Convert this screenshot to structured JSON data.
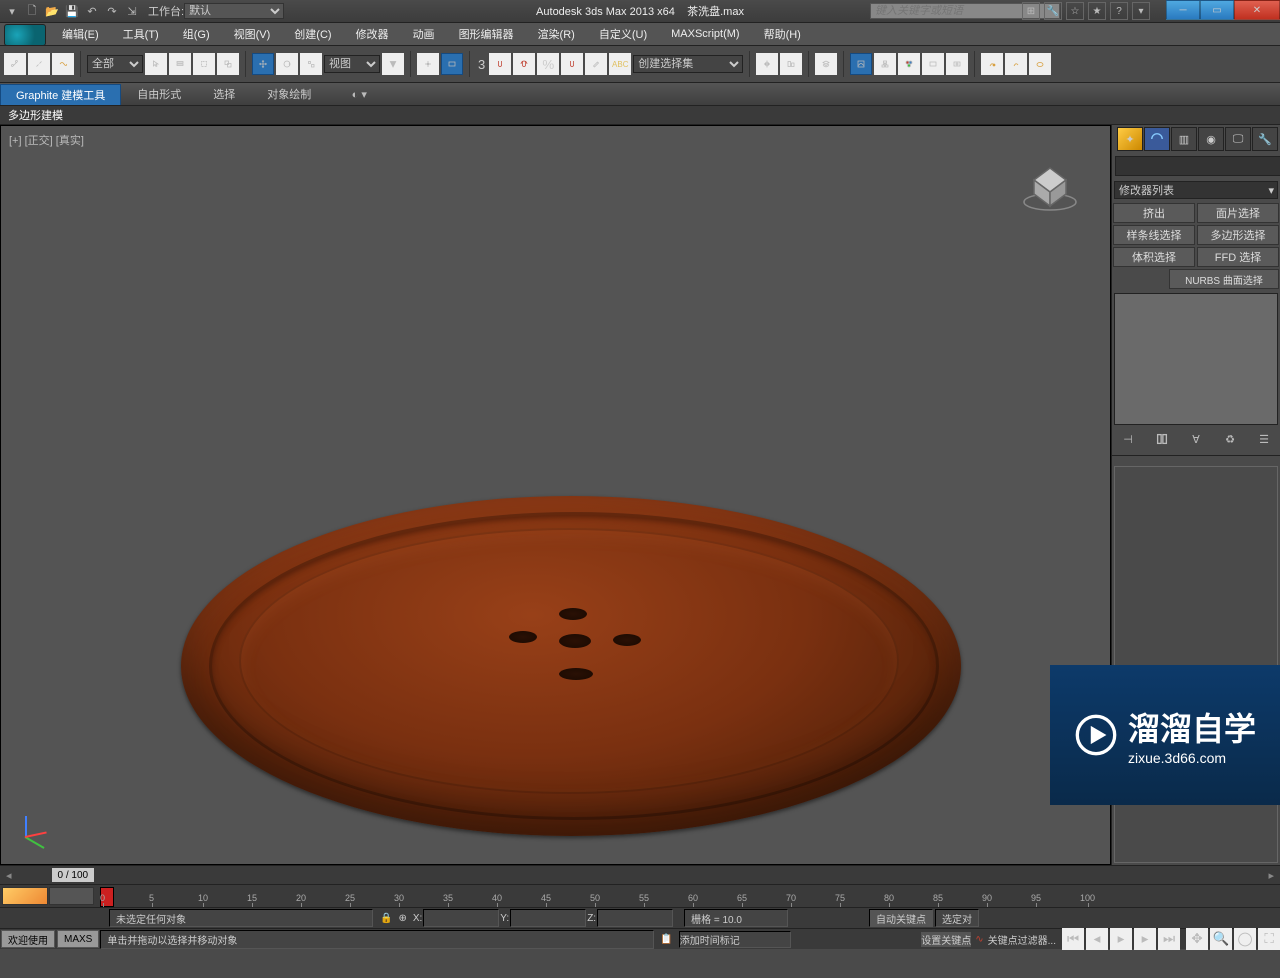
{
  "title": {
    "app": "Autodesk 3ds Max  2013 x64",
    "file": "茶洗盘.max"
  },
  "workspace": {
    "label": "工作台:",
    "value": "默认"
  },
  "search": {
    "placeholder": "键入关键字或短语"
  },
  "menubar": [
    "编辑(E)",
    "工具(T)",
    "组(G)",
    "视图(V)",
    "创建(C)",
    "修改器",
    "动画",
    "图形编辑器",
    "渲染(R)",
    "自定义(U)",
    "MAXScript(M)",
    "帮助(H)"
  ],
  "toolbar": {
    "sel_filter": "全部",
    "view_dd": "视图",
    "create_set": "创建选择集"
  },
  "ribbon": {
    "tabs": [
      "Graphite 建模工具",
      "自由形式",
      "选择",
      "对象绘制"
    ],
    "active": 0,
    "sub": "多边形建模"
  },
  "viewport": {
    "label": "[+] [正交] [真实]"
  },
  "cmdpanel": {
    "modlist": "修改器列表",
    "mod_btns": [
      [
        "挤出",
        "面片选择"
      ],
      [
        "样条线选择",
        "多边形选择"
      ],
      [
        "体积选择",
        "FFD 选择"
      ]
    ],
    "nurbs": "NURBS 曲面选择"
  },
  "time": {
    "frame": "0 / 100",
    "ticks": [
      0,
      5,
      10,
      15,
      20,
      25,
      30,
      35,
      40,
      45,
      50,
      55,
      60,
      65,
      70,
      75,
      80,
      85,
      90,
      95,
      100
    ]
  },
  "status": {
    "nosel": "未选定任何对象",
    "x": "X:",
    "y": "Y:",
    "z": "Z:",
    "grid": "栅格 = 10.0",
    "autokey": "自动关键点",
    "setkey": "设置关键点",
    "seldd": "选定对",
    "keyfilt": "关键点过滤器...",
    "addtag": "添加时间标记"
  },
  "prompt": {
    "welcome": "欢迎使用",
    "maxs": "MAXS",
    "hint": "单击并拖动以选择并移动对象"
  },
  "watermark": {
    "big": "溜溜自学",
    "sm": "zixue.3d66.com"
  }
}
